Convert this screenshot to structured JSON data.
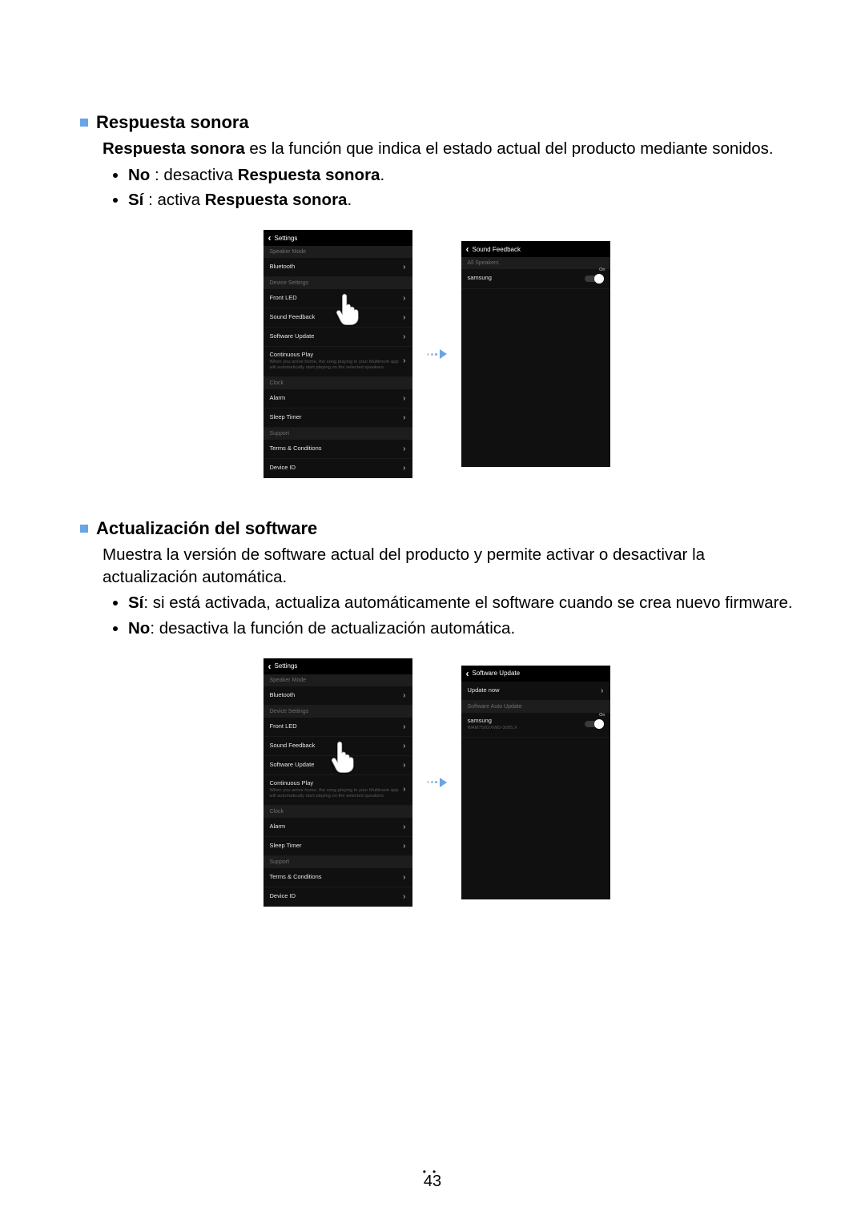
{
  "section1": {
    "title": "Respuesta sonora",
    "desc_bold": "Respuesta sonora",
    "desc_rest": " es la función que indica el estado actual del producto mediante sonidos.",
    "bullet_no_label": "No",
    "bullet_no_rest": " : desactiva ",
    "bullet_no_bold2": "Respuesta sonora",
    "bullet_no_end": ".",
    "bullet_si_label": "Sí",
    "bullet_si_rest": " : activa ",
    "bullet_si_bold2": "Respuesta sonora",
    "bullet_si_end": "."
  },
  "section2": {
    "title": "Actualización del software",
    "desc": "Muestra la versión de software actual del producto y permite activar o desactivar la actualización automática.",
    "bullet_si_label": "Sí",
    "bullet_si_rest": ": si está activada, actualiza automáticamente el software cuando se crea nuevo firmware.",
    "bullet_no_label": "No",
    "bullet_no_rest": ": desactiva la función de actualización automática."
  },
  "settings_screen": {
    "header": "Settings",
    "group_speaker": "Speaker Mode",
    "bluetooth": "Bluetooth",
    "group_device": "Device Settings",
    "front_led": "Front LED",
    "sound_feedback": "Sound Feedback",
    "software_update": "Software Update",
    "cont_play": "Continuous Play",
    "cont_play_sub": "When you arrive home, the song playing in your Multiroom app will automatically start playing on the selected speakers.",
    "group_clock": "Clock",
    "alarm": "Alarm",
    "sleep_timer": "Sleep Timer",
    "group_support": "Support",
    "terms": "Terms & Conditions",
    "device_id": "Device ID"
  },
  "sound_feedback_screen": {
    "header": "Sound Feedback",
    "group_all": "All Speakers",
    "speaker": "samsung",
    "on": "On"
  },
  "software_update_screen": {
    "header": "Software Update",
    "update_now": "Update now",
    "group_auto": "Software Auto Update",
    "speaker": "samsung",
    "version": "WAM7500/XWD-3005.X",
    "on": "On"
  },
  "page_number": "43"
}
